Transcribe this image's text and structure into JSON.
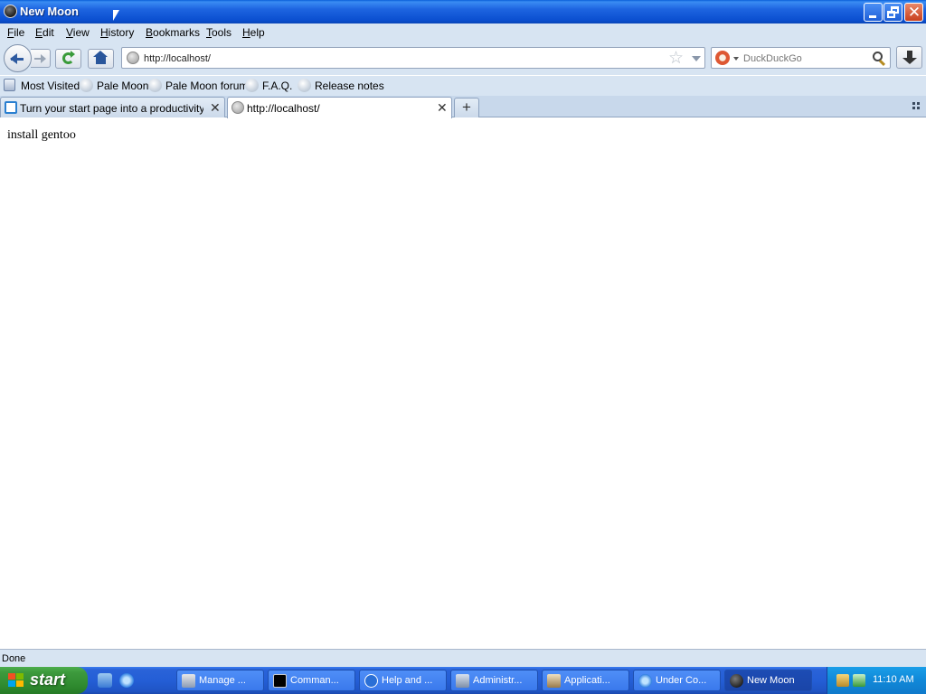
{
  "window": {
    "title": "New Moon"
  },
  "menu": [
    "File",
    "Edit",
    "View",
    "History",
    "Bookmarks",
    "Tools",
    "Help"
  ],
  "nav": {
    "url": "http://localhost/",
    "search_placeholder": "DuckDuckGo"
  },
  "bookmarks": [
    "Most Visited",
    "Pale Moon",
    "Pale Moon forum",
    "F.A.Q.",
    "Release notes"
  ],
  "tabs": [
    {
      "label": "Turn your start page into a productivity ..."
    },
    {
      "label": "http://localhost/"
    }
  ],
  "content": {
    "text": "install gentoo"
  },
  "status": {
    "text": "Done"
  },
  "taskbar": {
    "start_label": "start",
    "items": [
      "Manage ...",
      "Comman...",
      "Help and ...",
      "Administr...",
      "Applicati...",
      "Under Co...",
      "New Moon"
    ],
    "clock": "11:10 AM"
  }
}
